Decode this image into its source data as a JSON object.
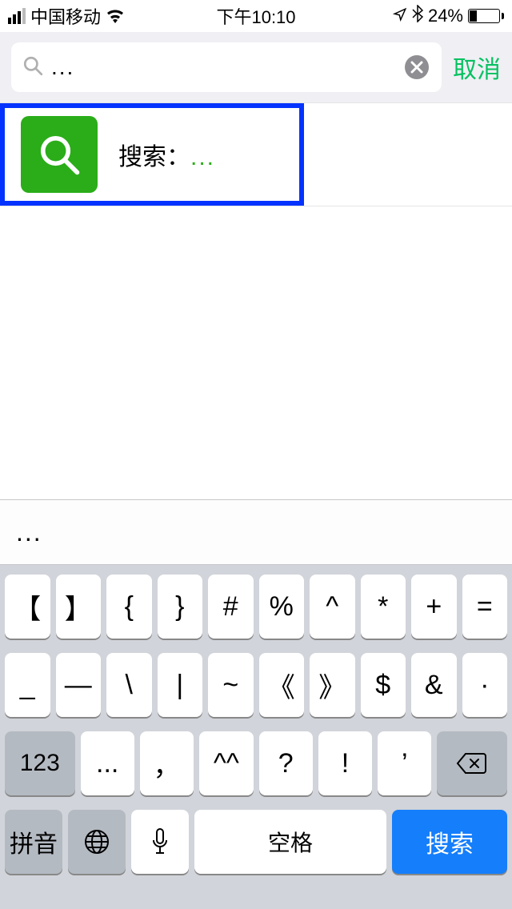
{
  "status": {
    "carrier": "中国移动",
    "time": "下午10:10",
    "battery_pct": "24%"
  },
  "search": {
    "input_value": "...",
    "cancel_label": "取消"
  },
  "result": {
    "prefix": "搜索：",
    "term": "..."
  },
  "suggestion": "...",
  "keyboard": {
    "row1": [
      "【",
      "】",
      "{",
      "}",
      "#",
      "%",
      "^",
      "*",
      "+",
      "="
    ],
    "row2": [
      "_",
      "—",
      "\\",
      "|",
      "~",
      "《",
      "》",
      "$",
      "&",
      "·"
    ],
    "row3_mode": "123",
    "row3": [
      "...",
      "，",
      "^^",
      "?",
      "!",
      "’"
    ],
    "row4": {
      "ime": "拼音",
      "space": "空格",
      "enter": "搜索"
    }
  }
}
